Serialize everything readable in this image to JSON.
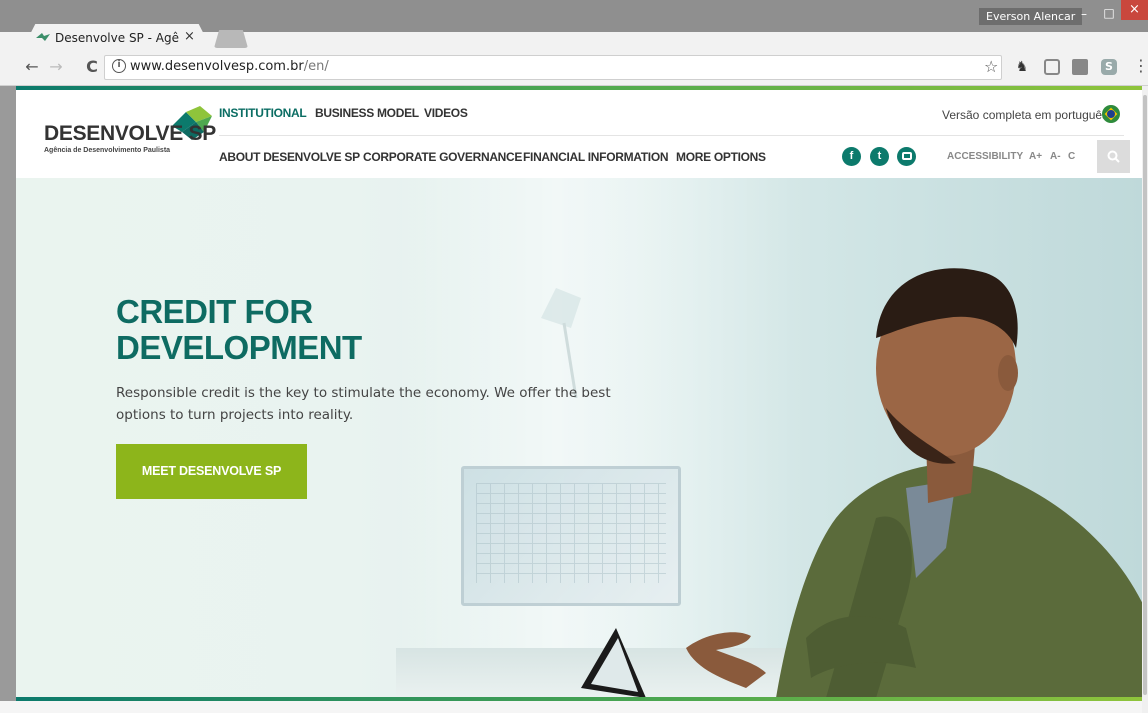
{
  "browser": {
    "tab_title": "Desenvolve SP - Agência",
    "tab_close": "×",
    "user_name": "Everson Alencar",
    "url_host": "www.desenvolvesp.com.br",
    "url_path": "/en/",
    "window_min": "–",
    "window_max": "□",
    "window_close": "×"
  },
  "site": {
    "logo": {
      "wordmark": "DESENVOLVE SP",
      "tagline": "Agência de Desenvolvimento Paulista"
    },
    "top_nav": [
      {
        "label": "INSTITUTIONAL"
      },
      {
        "label": "BUSINESS MODEL"
      },
      {
        "label": "VIDEOS"
      }
    ],
    "language_link": "Versão completa em português",
    "main_nav": [
      {
        "label": "ABOUT DESENVOLVE SP"
      },
      {
        "label": "CORPORATE GOVERNANCE"
      },
      {
        "label": "FINANCIAL INFORMATION"
      },
      {
        "label": "MORE OPTIONS"
      }
    ],
    "social": [
      "facebook-icon",
      "twitter-icon",
      "youtube-icon"
    ],
    "accessibility": {
      "label": "ACCESSIBILITY",
      "increase": "A+",
      "decrease": "A-",
      "contrast": "C"
    }
  },
  "hero": {
    "heading_line1": "CREDIT FOR",
    "heading_line2": "DEVELOPMENT",
    "text": "Responsible credit is the key to stimulate the economy. We offer the best options to turn projects into reality.",
    "cta_label": "MEET DESENVOLVE SP"
  },
  "colors": {
    "brand_teal": "#0e6b62",
    "brand_green": "#8db51b",
    "close_red": "#c9473d"
  }
}
